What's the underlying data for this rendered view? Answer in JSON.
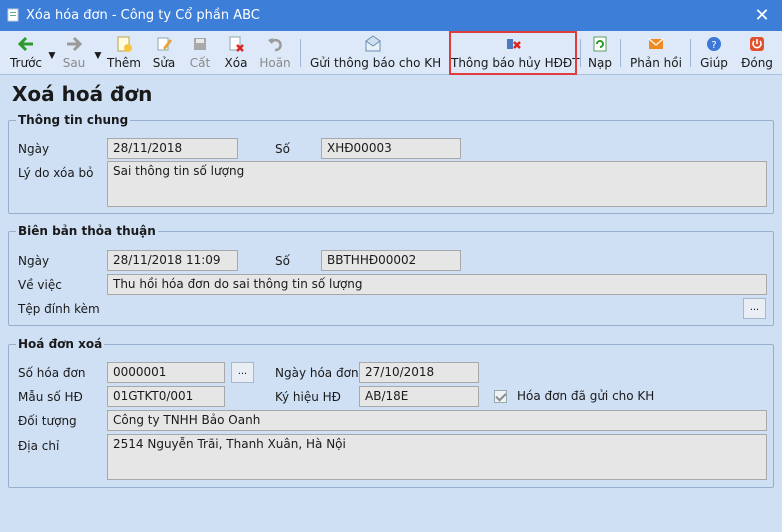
{
  "window": {
    "title": "Xóa hóa đơn - Công ty Cổ phần ABC"
  },
  "toolbar": {
    "prev": "Trước",
    "next": "Sau",
    "add": "Thêm",
    "edit": "Sửa",
    "save": "Cất",
    "delete": "Xóa",
    "undo": "Hoãn",
    "send_notice": "Gửi thông báo cho KH",
    "cancel_notice": "Thông báo hủy HĐĐT",
    "reload": "Nạp",
    "feedback": "Phản hồi",
    "help": "Giúp",
    "close": "Đóng"
  },
  "form_title": "Xoá hoá đơn",
  "general": {
    "title": "Thông tin chung",
    "date_label": "Ngày",
    "date_value": "28/11/2018",
    "no_label": "Số",
    "no_value": "XHĐ00003",
    "reason_label": "Lý do xóa bỏ",
    "reason_value": "Sai thông tin số lượng"
  },
  "agreement": {
    "title": "Biên bản thỏa thuận",
    "date_label": "Ngày",
    "date_value": "28/11/2018 11:09",
    "no_label": "Số",
    "no_value": "BBTHHĐ00002",
    "subject_label": "Về việc",
    "subject_value": "Thu hồi hóa đơn do sai thông tin số lượng",
    "attach_label": "Tệp đính kèm",
    "dots": "..."
  },
  "invoice": {
    "title": "Hoá đơn xoá",
    "no_label": "Số hóa đơn",
    "no_value": "0000001",
    "dots": "...",
    "date_label": "Ngày hóa đơn",
    "date_value": "27/10/2018",
    "template_label": "Mẫu số HĐ",
    "template_value": "01GTKT0/001",
    "symbol_label": "Ký hiệu HĐ",
    "symbol_value": "AB/18E",
    "sent_label": "Hóa đơn đã gửi cho KH",
    "object_label": "Đối tượng",
    "object_value": "Công ty TNHH Bảo Oanh",
    "address_label": "Địa chỉ",
    "address_value": "2514 Nguyễn Trãi, Thanh Xuân, Hà Nội"
  },
  "colors": {
    "titlebar": "#3d7fd8",
    "highlight": "#e03c3c",
    "background": "#cfe0f5"
  }
}
